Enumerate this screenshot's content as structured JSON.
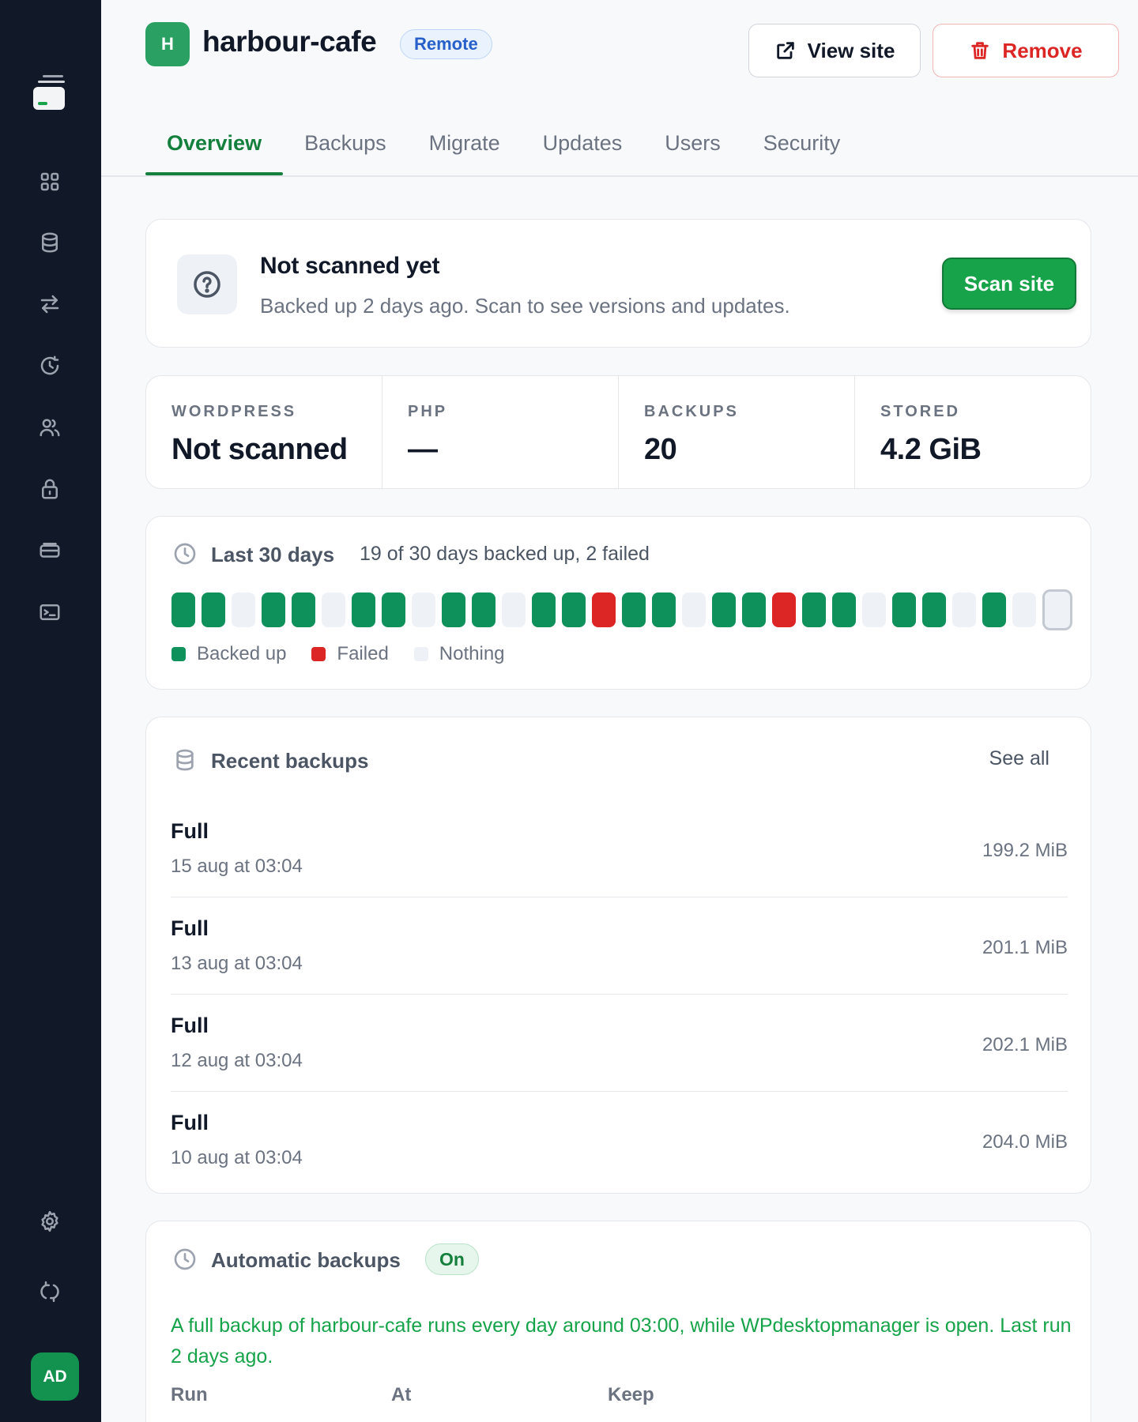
{
  "site": {
    "initial": "H",
    "name": "harbour-cafe",
    "badge": "Remote",
    "view_label": "View site",
    "remove_label": "Remove"
  },
  "tabs": [
    {
      "label": "Overview",
      "active": true
    },
    {
      "label": "Backups"
    },
    {
      "label": "Migrate"
    },
    {
      "label": "Updates"
    },
    {
      "label": "Users"
    },
    {
      "label": "Security"
    }
  ],
  "scan": {
    "title": "Not scanned yet",
    "subtitle": "Backed up 2 days ago. Scan to see versions and updates.",
    "button": "Scan site"
  },
  "stats": [
    {
      "label": "WORDPRESS",
      "value": "Not scanned"
    },
    {
      "label": "PHP",
      "value": "—"
    },
    {
      "label": "BACKUPS",
      "value": "20"
    },
    {
      "label": "STORED",
      "value": "4.2 GiB"
    }
  ],
  "days": {
    "title": "Last 30 days",
    "summary": "19 of 30 days backed up, 2 failed",
    "status": [
      "ok",
      "ok",
      "none",
      "ok",
      "ok",
      "none",
      "ok",
      "ok",
      "none",
      "ok",
      "ok",
      "none",
      "ok",
      "ok",
      "fail",
      "ok",
      "ok",
      "none",
      "ok",
      "ok",
      "fail",
      "ok",
      "ok",
      "none",
      "ok",
      "ok",
      "none",
      "ok",
      "none",
      "today"
    ],
    "legend": {
      "ok": "Backed up",
      "fail": "Failed",
      "none": "Nothing"
    },
    "colors": {
      "ok": "#0f915b",
      "fail": "#dc2626",
      "none": "#eef1f5"
    }
  },
  "recent": {
    "title": "Recent backups",
    "see_all": "See all",
    "rows": [
      {
        "type": "Full",
        "date": "15 aug at 03:04",
        "size": "199.2 MiB"
      },
      {
        "type": "Full",
        "date": "13 aug at 03:04",
        "size": "201.1 MiB"
      },
      {
        "type": "Full",
        "date": "12 aug at 03:04",
        "size": "202.1 MiB"
      },
      {
        "type": "Full",
        "date": "10 aug at 03:04",
        "size": "204.0 MiB"
      }
    ]
  },
  "auto": {
    "title": "Automatic backups",
    "status": "On",
    "text": "A full backup of harbour-cafe runs every day around 03:00, while WPdesktopmanager is open. Last run 2 days ago.",
    "columns": [
      "Run",
      "At",
      "Keep"
    ]
  },
  "user": {
    "initials": "AD"
  },
  "icons": [
    "logo-icon",
    "dashboard-icon",
    "database-icon",
    "transfer-icon",
    "history-icon",
    "users-icon",
    "lock-icon",
    "card-icon",
    "terminal-icon",
    "settings-icon",
    "sync-icon"
  ]
}
